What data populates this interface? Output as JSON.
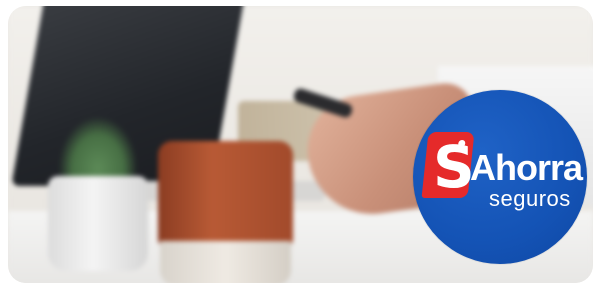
{
  "logo": {
    "mark_letter": "S",
    "name": "Ahorra",
    "subtitle": "seguros",
    "badge_color": "#1453b5",
    "tag_color": "#e52a2a"
  },
  "background_photo": {
    "colors": {
      "laptop": "#22252a",
      "mug": "#b85a35",
      "plant": "#5c8a57"
    }
  }
}
